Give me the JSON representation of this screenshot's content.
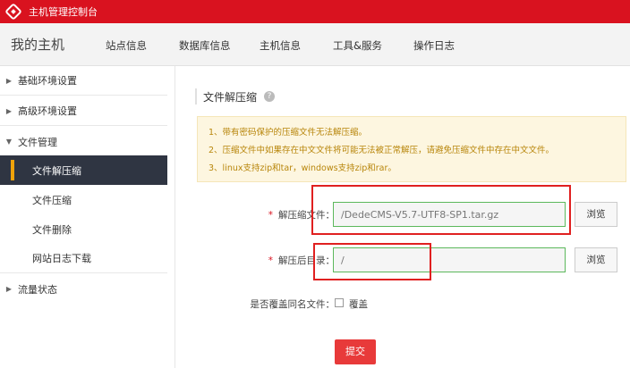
{
  "topbar": {
    "title": "主机管理控制台"
  },
  "nav": {
    "brand": "我的主机",
    "items": [
      "站点信息",
      "数据库信息",
      "主机信息",
      "工具&服务",
      "操作日志"
    ]
  },
  "sidebar": {
    "groups": [
      {
        "label": "基础环境设置"
      },
      {
        "label": "高级环境设置"
      },
      {
        "label": "文件管理"
      },
      {
        "label": "流量状态"
      }
    ],
    "file_items": [
      "文件解压缩",
      "文件压缩",
      "文件删除",
      "网站日志下载"
    ],
    "active": "文件解压缩"
  },
  "main": {
    "section_title": "文件解压缩",
    "help": "?",
    "notices": [
      "1、带有密码保护的压缩文件无法解压缩。",
      "2、压缩文件中如果存在中文文件将可能无法被正常解压，请避免压缩文件中存在中文文件。",
      "3、linux支持zip和tar，windows支持zip和rar。"
    ],
    "required_mark": "*",
    "unzip_file_label": "解压缩文件：",
    "unzip_file_value": "/DedeCMS-V5.7-UTF8-SP1.tar.gz",
    "target_dir_label": "解压后目录：",
    "target_dir_value": "/",
    "browse_label": "浏览",
    "overwrite_label": "是否覆盖同名文件：",
    "overwrite_checkbox_label": "覆盖",
    "overwrite_checked": false,
    "submit_label": "提交"
  },
  "colors": {
    "topbar": "#d9121f",
    "active_sidebar": "#2f3542",
    "accent_bar": "#f0a30a",
    "submit": "#e83a3a",
    "annotation": "#e02020"
  }
}
